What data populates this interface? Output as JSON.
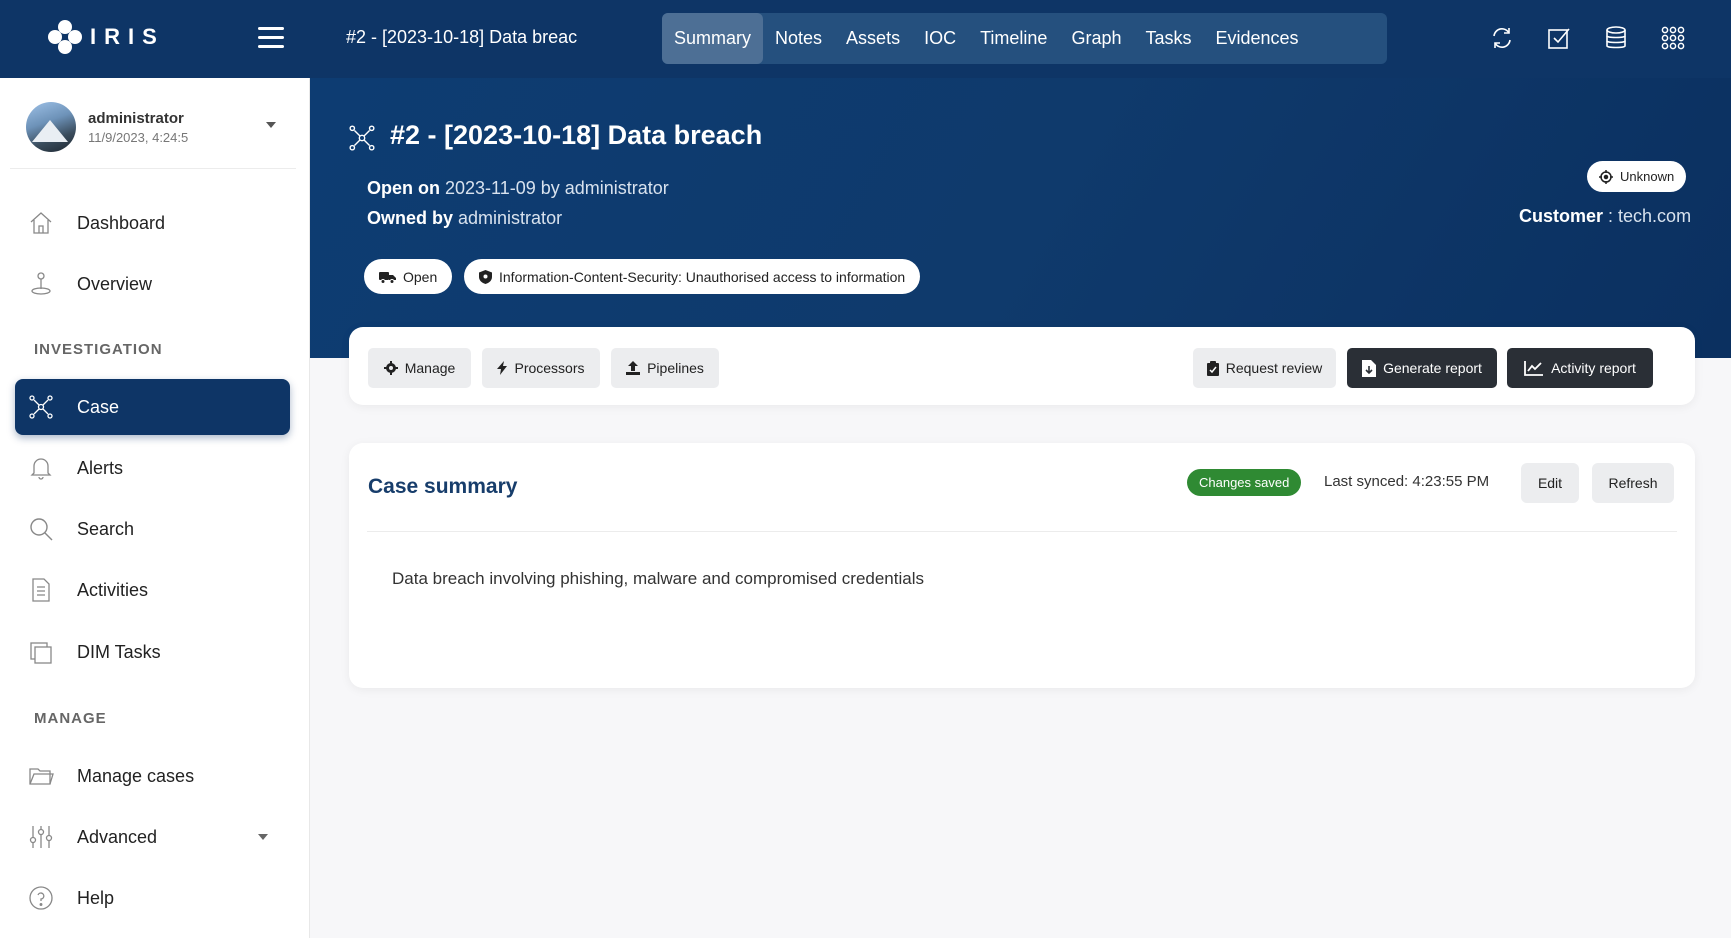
{
  "app": {
    "logo_text": "IRIS"
  },
  "topbar": {
    "case_title": "#2 - [2023-10-18] Data breac",
    "tabs": [
      {
        "label": "Summary",
        "active": true
      },
      {
        "label": "Notes"
      },
      {
        "label": "Assets"
      },
      {
        "label": "IOC"
      },
      {
        "label": "Timeline"
      },
      {
        "label": "Graph"
      },
      {
        "label": "Tasks"
      },
      {
        "label": "Evidences"
      }
    ],
    "icons": [
      "sync-icon",
      "check-square-icon",
      "database-icon",
      "apps-grid-icon"
    ]
  },
  "user": {
    "name": "administrator",
    "date": "11/9/2023, 4:24:5"
  },
  "sidebar": {
    "items": [
      {
        "label": "Dashboard",
        "icon": "home-icon"
      },
      {
        "label": "Overview",
        "icon": "overview-icon"
      }
    ],
    "section_investigation": "INVESTIGATION",
    "investigation_items": [
      {
        "label": "Case",
        "icon": "network-icon",
        "active": true
      },
      {
        "label": "Alerts",
        "icon": "bell-icon"
      },
      {
        "label": "Search",
        "icon": "search-icon"
      },
      {
        "label": "Activities",
        "icon": "document-icon"
      },
      {
        "label": "DIM Tasks",
        "icon": "copy-icon"
      }
    ],
    "section_manage": "MANAGE",
    "manage_items": [
      {
        "label": "Manage cases",
        "icon": "folder-icon"
      },
      {
        "label": "Advanced",
        "icon": "sliders-icon"
      },
      {
        "label": "Help",
        "icon": "help-icon"
      }
    ]
  },
  "case": {
    "title": "#2 - [2023-10-18] Data breach",
    "open_label": "Open on",
    "open_value": "2023-11-09 by administrator",
    "owned_label": "Owned by",
    "owned_value": "administrator",
    "state_pill": "Open",
    "classification_pill": "Information-Content-Security: Unauthorised access to information",
    "severity": "Unknown",
    "customer_label": "Customer",
    "customer_value": ": tech.com"
  },
  "actions": {
    "manage": "Manage",
    "processors": "Processors",
    "pipelines": "Pipelines",
    "request_review": "Request review",
    "generate_report": "Generate report",
    "activity_report": "Activity report"
  },
  "summary": {
    "title": "Case summary",
    "status_badge": "Changes saved",
    "last_synced": "Last synced: 4:23:55 PM",
    "edit": "Edit",
    "refresh": "Refresh",
    "text": "Data breach involving phishing, malware and compromised credentials"
  },
  "colors": {
    "navy": "#0e3566",
    "tab_bar": "#25507e",
    "tab_active": "#4d6f95",
    "badge_green": "#2f8a33",
    "dark_button": "#2a2f36"
  }
}
